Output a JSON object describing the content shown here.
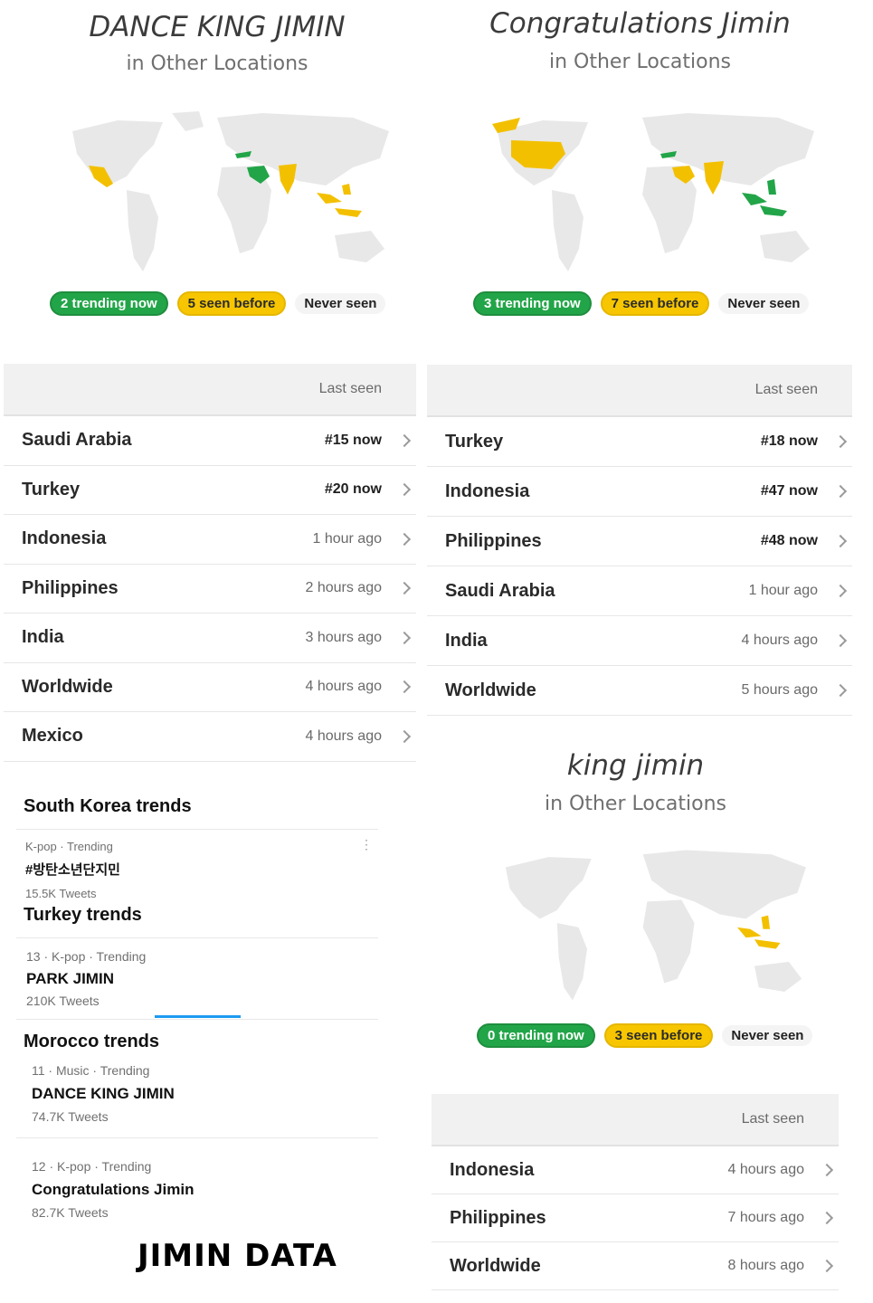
{
  "panels": {
    "left": {
      "title": "DANCE KING JIMIN",
      "subtitle": "in Other Locations",
      "legend": {
        "trending": "2 trending now",
        "seen": "5 seen before",
        "never": "Never seen"
      },
      "header": "Last seen",
      "rows": [
        {
          "location": "Saudi Arabia",
          "last_seen": "#15 now",
          "now": true
        },
        {
          "location": "Turkey",
          "last_seen": "#20 now",
          "now": true
        },
        {
          "location": "Indonesia",
          "last_seen": "1 hour ago",
          "now": false
        },
        {
          "location": "Philippines",
          "last_seen": "2 hours ago",
          "now": false
        },
        {
          "location": "India",
          "last_seen": "3 hours ago",
          "now": false
        },
        {
          "location": "Worldwide",
          "last_seen": "4 hours ago",
          "now": false
        },
        {
          "location": "Mexico",
          "last_seen": "4 hours ago",
          "now": false
        }
      ]
    },
    "right": {
      "title": "Congratulations Jimin",
      "subtitle": "in Other Locations",
      "legend": {
        "trending": "3 trending now",
        "seen": "7 seen before",
        "never": "Never seen"
      },
      "header": "Last seen",
      "rows": [
        {
          "location": "Turkey",
          "last_seen": "#18 now",
          "now": true
        },
        {
          "location": "Indonesia",
          "last_seen": "#47 now",
          "now": true
        },
        {
          "location": "Philippines",
          "last_seen": "#48 now",
          "now": true
        },
        {
          "location": "Saudi Arabia",
          "last_seen": "1 hour ago",
          "now": false
        },
        {
          "location": "India",
          "last_seen": "4 hours ago",
          "now": false
        },
        {
          "location": "Worldwide",
          "last_seen": "5 hours ago",
          "now": false
        }
      ]
    },
    "bottom_right": {
      "title": "king jimin",
      "subtitle": "in Other Locations",
      "legend": {
        "trending": "0 trending now",
        "seen": "3 seen before",
        "never": "Never seen"
      },
      "header": "Last seen",
      "rows": [
        {
          "location": "Indonesia",
          "last_seen": "4 hours ago",
          "now": false
        },
        {
          "location": "Philippines",
          "last_seen": "7 hours ago",
          "now": false
        },
        {
          "location": "Worldwide",
          "last_seen": "8 hours ago",
          "now": false
        }
      ]
    }
  },
  "trends": {
    "south_korea": {
      "heading": "South Korea trends",
      "meta": "K-pop · Trending",
      "name": "#방탄소년단지민",
      "tweets": "15.5K Tweets"
    },
    "turkey": {
      "heading": "Turkey trends",
      "meta": "13 · K-pop · Trending",
      "name": "PARK JIMIN",
      "tweets": "210K Tweets"
    },
    "morocco": {
      "heading": "Morocco trends",
      "items": [
        {
          "meta": "11 · Music · Trending",
          "name": "DANCE KING JIMIN",
          "tweets": "74.7K Tweets"
        },
        {
          "meta": "12 · K-pop · Trending",
          "name": "Congratulations Jimin",
          "tweets": "82.7K Tweets"
        }
      ]
    }
  },
  "footer": "JIMIN DATA",
  "colors": {
    "trending": "#22a548",
    "seen": "#f7c600",
    "land": "#e8e8e8"
  },
  "icons": {
    "more": "more-vertical-icon",
    "chevron": "chevron-right-icon"
  }
}
